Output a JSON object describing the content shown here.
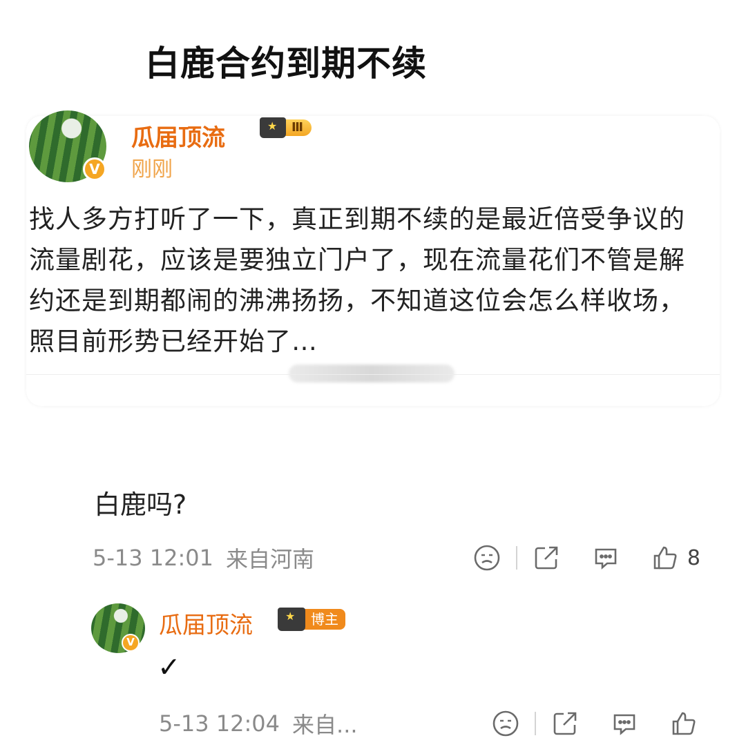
{
  "headline": "白鹿合约到期不续",
  "post": {
    "author": "瓜届顶流",
    "badge_rank": "Ⅲ",
    "time": "刚刚",
    "text": "找人多方打听了一下，真正到期不续的是最近倍受争议的流量剧花，应该是要独立门户了，现在流量花们不管是解约还是到期都闹的沸沸扬扬，不知道这位会怎么样收场，照目前形势已经开始了…"
  },
  "comment": {
    "text": "白鹿吗?",
    "time": "5-13 12:01",
    "location": "来自河南",
    "like_count": "8"
  },
  "reply": {
    "author": "瓜届顶流",
    "tag": "博主",
    "text": "✓",
    "time": "5-13 12:04",
    "location": "来自..."
  },
  "icons": [
    "smile-icon",
    "share-icon",
    "comment-icon",
    "like-icon"
  ],
  "colors": {
    "author": "#e86c12",
    "badge": "#f5a623",
    "meta": "#8a8a8a"
  }
}
